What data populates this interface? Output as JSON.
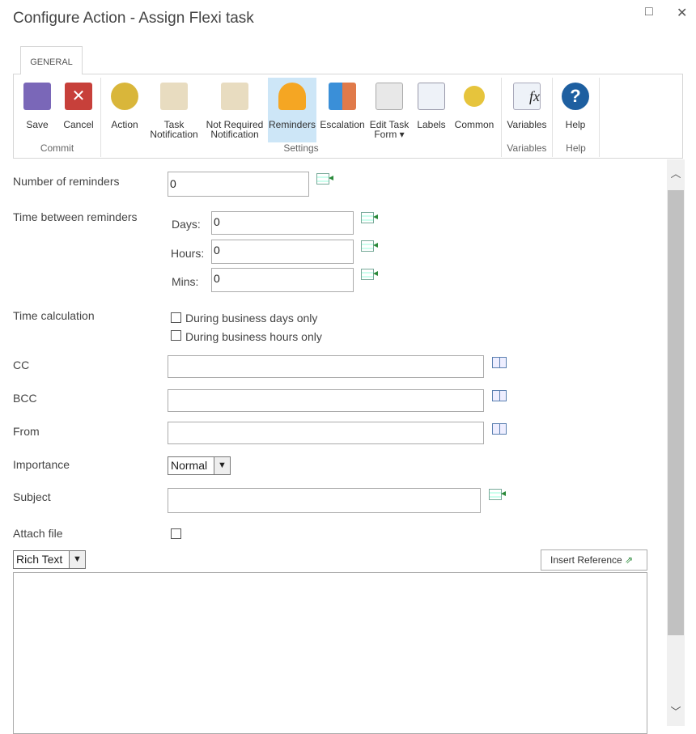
{
  "window": {
    "title": "Configure Action - Assign Flexi task",
    "maximize_icon": "□",
    "close_icon": "✕"
  },
  "ribbon": {
    "tab": "GENERAL",
    "groups": {
      "commit": "Commit",
      "settings": "Settings",
      "variables": "Variables",
      "help": "Help"
    },
    "buttons": {
      "save": "Save",
      "cancel": "Cancel",
      "action": "Action",
      "task_notification": "Task Notification",
      "not_required": "Not Required Notification",
      "reminders": "Reminders",
      "escalation": "Escalation",
      "edit_task_form": "Edit Task Form ▾",
      "labels": "Labels",
      "common": "Common",
      "variables": "Variables",
      "help": "Help"
    }
  },
  "form": {
    "number_of_reminders": {
      "label": "Number of reminders",
      "value": "0"
    },
    "time_between": {
      "label": "Time between reminders",
      "days_label": "Days:",
      "days": "0",
      "hours_label": "Hours:",
      "hours": "0",
      "mins_label": "Mins:",
      "mins": "0"
    },
    "time_calc": {
      "label": "Time calculation",
      "opt1": "During business days only",
      "opt2": "During business hours only"
    },
    "cc": {
      "label": "CC",
      "value": ""
    },
    "bcc": {
      "label": "BCC",
      "value": ""
    },
    "from": {
      "label": "From",
      "value": ""
    },
    "importance": {
      "label": "Importance",
      "value": "Normal"
    },
    "subject": {
      "label": "Subject",
      "value": ""
    },
    "attach": {
      "label": "Attach file"
    },
    "format": {
      "value": "Rich Text"
    },
    "insert_reference": "Insert Reference",
    "body": ""
  },
  "colors": {
    "selected": "#cde6f7",
    "scrollbar": "#c1c1c1"
  }
}
